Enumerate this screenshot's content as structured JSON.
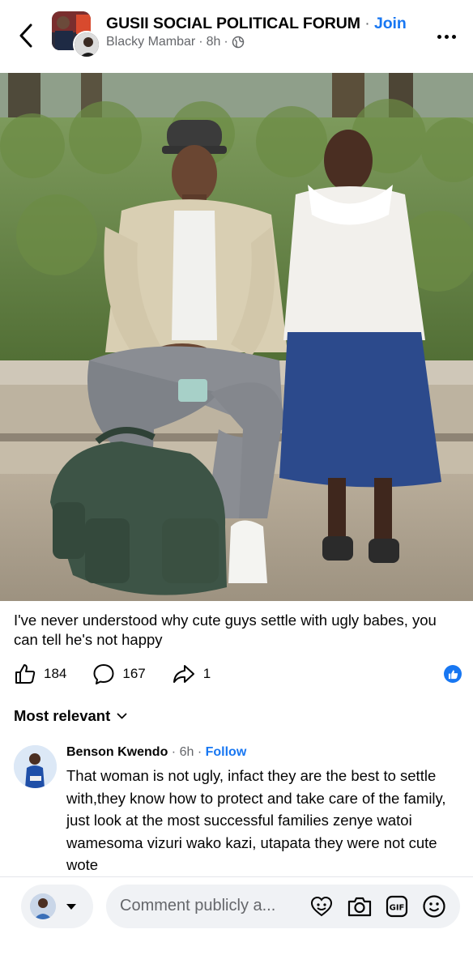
{
  "header": {
    "group_name": "GUSII SOCIAL POLITICAL FORUM",
    "separator": "·",
    "join_label": "Join",
    "author": "Blacky Mambar",
    "time": "8h",
    "audience_icon": "globe-icon"
  },
  "post": {
    "caption": "I've never understood why cute guys settle with ugly babes, you can tell he's not happy",
    "likes": "184",
    "comments": "167",
    "shares": "1"
  },
  "sort": {
    "label": "Most relevant"
  },
  "comment": {
    "author": "Benson Kwendo",
    "time": "6h",
    "follow_label": "Follow",
    "text": "That woman is not ugly, infact they are the best to settle with,they know how to protect and take care of the family, just look at the most successful families zenye watoi wamesoma vizuri wako kazi, utapata they were not cute wote"
  },
  "composer": {
    "placeholder": "Comment publicly a..."
  },
  "colors": {
    "accent": "#1877f2",
    "muted": "#65676b",
    "field": "#f0f2f5"
  }
}
